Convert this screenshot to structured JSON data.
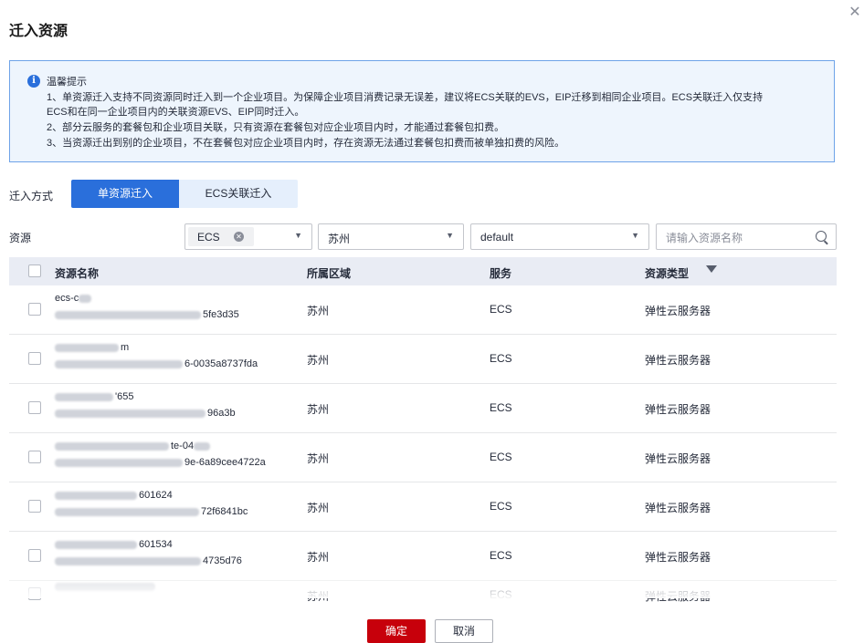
{
  "dialog": {
    "title": "迁入资源"
  },
  "notice": {
    "title": "温馨提示",
    "lines": [
      "1、单资源迁入支持不同资源同时迁入到一个企业项目。为保障企业项目消费记录无误差，建议将ECS关联的EVS，EIP迁移到相同企业项目。ECS关联迁入仅支持",
      "ECS和在同一企业项目内的关联资源EVS、EIP同时迁入。",
      "2、部分云服务的套餐包和企业项目关联，只有资源在套餐包对应企业项目内时，才能通过套餐包扣费。",
      "3、当资源迁出到别的企业项目，不在套餐包对应企业项目内时，存在资源无法通过套餐包扣费而被单独扣费的风险。"
    ]
  },
  "migration": {
    "label": "迁入方式",
    "tabs": [
      "单资源迁入",
      "ECS关联迁入"
    ]
  },
  "filters": {
    "label": "资源",
    "service_chip": "ECS",
    "region": "苏州",
    "project": "default",
    "search_placeholder": "请输入资源名称"
  },
  "table": {
    "headers": [
      "资源名称",
      "所属区域",
      "服务",
      "资源类型"
    ],
    "rows": [
      {
        "name1": "ecs-c",
        "name2": "5fe3d35",
        "region": "苏州",
        "service": "ECS",
        "type": "弹性云服务器"
      },
      {
        "name1": "m",
        "name2": "6-0035a8737fda",
        "region": "苏州",
        "service": "ECS",
        "type": "弹性云服务器"
      },
      {
        "name1": "'655",
        "name2": "96a3b",
        "region": "苏州",
        "service": "ECS",
        "type": "弹性云服务器"
      },
      {
        "name1": "te-04",
        "name2": "9e-6a89cee4722a",
        "region": "苏州",
        "service": "ECS",
        "type": "弹性云服务器"
      },
      {
        "name1": "601624",
        "name2": "72f6841bc",
        "region": "苏州",
        "service": "ECS",
        "type": "弹性云服务器"
      },
      {
        "name1": "601534",
        "name2": "4735d76",
        "region": "苏州",
        "service": "ECS",
        "type": "弹性云服务器"
      },
      {
        "name1": "",
        "name2": "",
        "region": "苏州",
        "service": "ECS",
        "type": "弹性云服务器"
      }
    ]
  },
  "footer": {
    "ok": "确定",
    "cancel": "取消"
  },
  "colors": {
    "primary": "#2a6fdb",
    "danger": "#c7000b",
    "notice_bg": "#eef5fd",
    "header_bg": "#e9ecf4"
  }
}
